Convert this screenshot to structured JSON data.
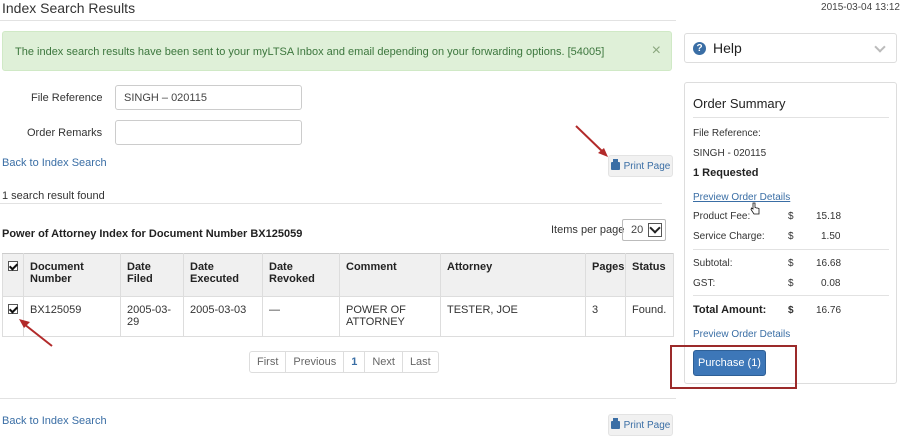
{
  "page": {
    "title": "Index Search Results",
    "timestamp": "2015-03-04 13:12"
  },
  "alert": {
    "message": "The index search results have been sent to your myLTSA Inbox and email depending on your forwarding options. [54005]",
    "close_glyph": "×"
  },
  "form": {
    "file_reference_label": "File Reference",
    "file_reference_value": "SINGH – 020115",
    "order_remarks_label": "Order Remarks",
    "order_remarks_value": ""
  },
  "links": {
    "back_to_search": "Back to Index Search"
  },
  "print_button": {
    "label": "Print Page",
    "icon": "printer-icon"
  },
  "results": {
    "count_text": "1 search result found",
    "section_title": "Power of Attorney Index for Document Number BX125059",
    "items_per_page_label": "Items per page",
    "items_per_page_value": "20",
    "columns": [
      "Document Number",
      "Date Filed",
      "Date Executed",
      "Date Revoked",
      "Comment",
      "Attorney",
      "Pages",
      "Status"
    ],
    "rows": [
      {
        "document_number": "BX125059",
        "date_filed": "2005-03-29",
        "date_executed": "2005-03-03",
        "date_revoked": "—",
        "comment": "POWER OF ATTORNEY",
        "attorney": "TESTER, JOE",
        "pages": "3",
        "status": "Found."
      }
    ]
  },
  "pager": {
    "first": "First",
    "previous": "Previous",
    "current": "1",
    "next": "Next",
    "last": "Last"
  },
  "help": {
    "title": "Help",
    "icon_glyph": "?"
  },
  "order_summary": {
    "title": "Order Summary",
    "file_reference_label": "File Reference:",
    "file_reference_value": "SINGH - 020115",
    "requested": "1 Requested",
    "preview_link": "Preview Order Details",
    "product_fee_label": "Product Fee:",
    "product_fee_currency": "$",
    "product_fee_value": "15.18",
    "service_charge_label": "Service Charge:",
    "service_charge_currency": "$",
    "service_charge_value": "1.50",
    "subtotal_label": "Subtotal:",
    "subtotal_currency": "$",
    "subtotal_value": "16.68",
    "gst_label": "GST:",
    "gst_currency": "$",
    "gst_value": "0.08",
    "total_label": "Total Amount:",
    "total_currency": "$",
    "total_value": "16.76",
    "purchase_button": "Purchase (1)"
  },
  "colors": {
    "annotation_red": "#b22a2a",
    "link_blue": "#3a6ea5",
    "alert_green_bg": "#dff0d8",
    "primary_button": "#3d77b8"
  }
}
